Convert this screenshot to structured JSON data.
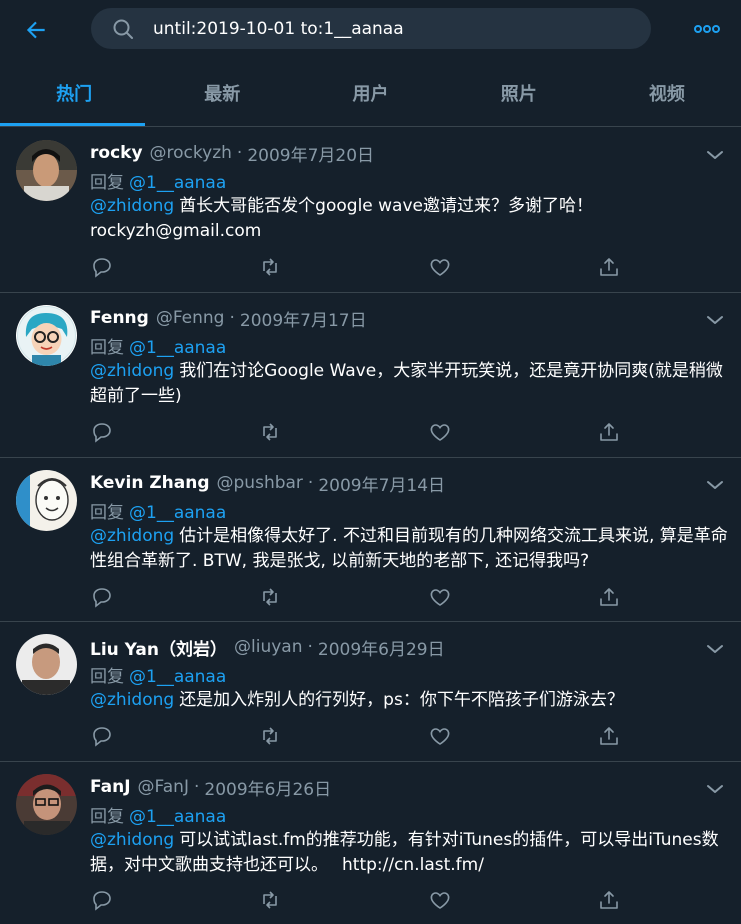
{
  "search": {
    "query": "until:2019-10-01 to:1__aanaa"
  },
  "tabs": [
    "热门",
    "最新",
    "用户",
    "照片",
    "视频"
  ],
  "tweets": [
    {
      "name": "rocky",
      "handle": "@rockyzh",
      "sep": "·",
      "date": "2009年7月20日",
      "reply_prefix": "回复",
      "reply_to": "@1__aanaa",
      "mention": "@zhidong",
      "text": "酋长大哥能否发个google wave邀请过来？多谢了哈！ rockyzh@gmail.com",
      "link": ""
    },
    {
      "name": "Fenng",
      "handle": "@Fenng",
      "sep": "·",
      "date": "2009年7月17日",
      "reply_prefix": "回复",
      "reply_to": "@1__aanaa",
      "mention": "@zhidong",
      "text": "我们在讨论Google Wave，大家半开玩笑说，还是竟开协同爽(就是稍微超前了一些)",
      "link": ""
    },
    {
      "name": "Kevin Zhang",
      "handle": "@pushbar",
      "sep": "·",
      "date": "2009年7月14日",
      "reply_prefix": "回复",
      "reply_to": "@1__aanaa",
      "mention": "@zhidong",
      "text": "估计是相像得太好了. 不过和目前现有的几种网络交流工具来说, 算是革命性组合革新了. BTW, 我是张戈, 以前新天地的老部下, 还记得我吗?",
      "link": ""
    },
    {
      "name": "Liu Yan（刘岩）",
      "handle": "@liuyan",
      "sep": "·",
      "date": "2009年6月29日",
      "reply_prefix": "回复",
      "reply_to": "@1__aanaa",
      "mention": "@zhidong",
      "text": "还是加入炸别人的行列好，ps：你下午不陪孩子们游泳去？",
      "link": ""
    },
    {
      "name": "FanJ",
      "handle": "@FanJ",
      "sep": "·",
      "date": "2009年6月26日",
      "reply_prefix": "回复",
      "reply_to": "@1__aanaa",
      "mention": "@zhidong",
      "text": "可以试试last.fm的推荐功能，有针对iTunes的插件，可以导出iTunes数据，对中文歌曲支持也还可以。",
      "link": "http://cn.last.fm/"
    }
  ],
  "colors": {
    "background": "#15202b",
    "accent": "#1da1f2",
    "muted": "#8899a6",
    "divider": "#38444d",
    "search_bg": "#253341"
  },
  "icons": {
    "back": "arrow-left-icon",
    "search": "search-icon",
    "more": "more-dots-icon",
    "caret": "chevron-down-icon",
    "reply": "reply-icon",
    "retweet": "retweet-icon",
    "like": "heart-icon",
    "share": "share-icon"
  }
}
